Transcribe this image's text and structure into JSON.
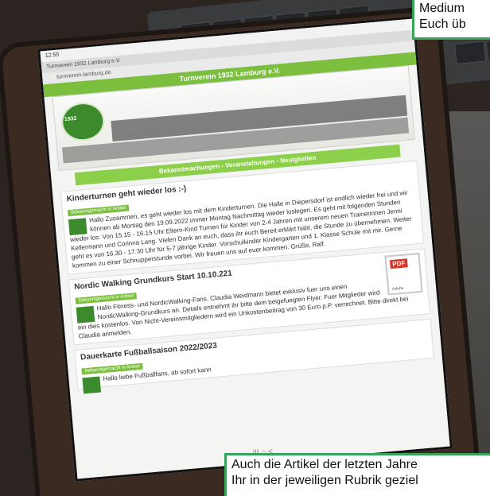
{
  "overlay_top": {
    "line1": "Medium",
    "line2": "Euch üb"
  },
  "overlay_bottom": {
    "line1": "Auch die Artikel der letzten Jahre",
    "line2": "Ihr in der jeweiligen Rubrik geziel"
  },
  "browser": {
    "status_time": "12:55",
    "tab_label": "Turnverein 1932 Lamburg e.V.",
    "url": "turnverein-lamburg.de"
  },
  "site": {
    "header_title": "Turnverein 1932 Lamburg e.V.",
    "logo_text": "1932",
    "nav_strip": "Bekanntmachungen - Veranstaltungen - Neuigkeiten"
  },
  "articles": [
    {
      "title": "Kinderturnen geht wieder los :-)",
      "meta": "Bekanntgemacht in Artikel",
      "body": "Hallo Zusammen, es geht wieder los mit dem Kinderturnen. Die Halle in Diepersdorf ist endlich wieder frei und wir können ab Montag den 19.09.2022 immer Montag Nachmittag wieder loslegen. Es geht mit folgenden Stunden wieder los: Von 15.15 - 16.15 Uhr Eltern-Kind Turnen für Kinder von 2-4 Jahren mit unserem neuen Trainerinnen Jenni Kellermann und Corinna Lang. Vielen Dank an euch, dass ihr euch Bereit erklärt habt, die Stunde zu übernehmen. Weiter geht es von 16.30 - 17.30 Uhr für 5-7 jährige Kinder. Vorschulkinder Kindergarten und 1. Klasse Schule mit mir. Gerne kommen zu einer Schnupperstunde vorbei. Wir freuen uns auf euer kommen. Grüße, Ralf."
    },
    {
      "title": "Nordic Walking Grundkurs Start 10.10.221",
      "meta": "Bekanntgemacht in Artikel",
      "body": "Hallo Fitness- und NordicWalking-Fans, Claudia Weidmann bietet exklusiv fuer uns einen NordicWalking-Grundkurs an. Details entnehmt ihr bitte dem beigefuegten Flyer. Fuer Mitglieder wird ein dies kostenlos. Von Nicht-Vereinsmitgliedern wird ein Unkostenbeitrag von 30 Euro p.P. verrechnet. Bitte direkt bei Claudia anmelden.",
      "pdf_label": "PDF",
      "pdf_sub": "Adobe"
    },
    {
      "title": "Dauerkarte Fußballsaison 2022/2023",
      "meta": "Bekanntgemacht in Artikel",
      "body": "Hallo liebe Fußballfans, ab sofort kann"
    }
  ],
  "nav_buttons": "|||   ○   <"
}
